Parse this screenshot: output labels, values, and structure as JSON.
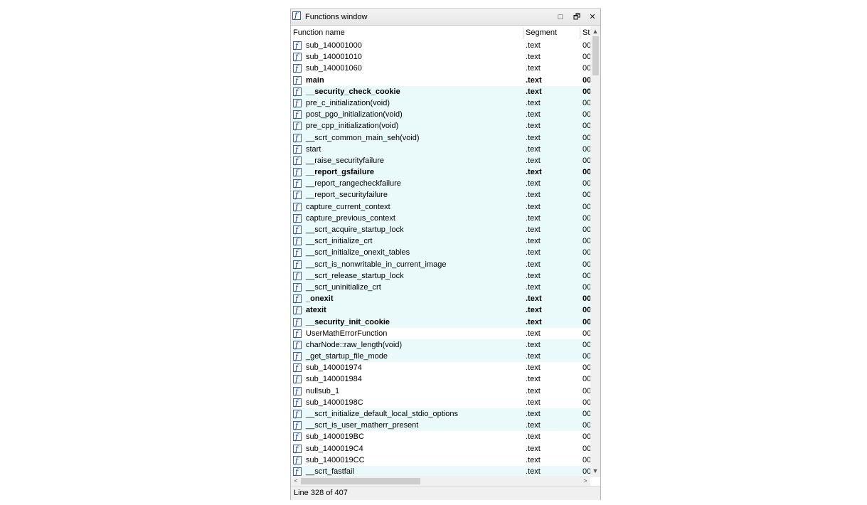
{
  "window": {
    "title": "Functions window",
    "buttons": {
      "maximize": "□",
      "restore": "🗗",
      "close": "✕"
    }
  },
  "columns": {
    "name": "Function name",
    "segment": "Segment",
    "start": "St"
  },
  "rows": [
    {
      "name": "sub_140001000",
      "segment": ".text",
      "start": "00",
      "bold": false,
      "highlight": false
    },
    {
      "name": "sub_140001010",
      "segment": ".text",
      "start": "00",
      "bold": false,
      "highlight": false
    },
    {
      "name": "sub_140001060",
      "segment": ".text",
      "start": "00",
      "bold": false,
      "highlight": false
    },
    {
      "name": "main",
      "segment": ".text",
      "start": "00",
      "bold": true,
      "highlight": false
    },
    {
      "name": "__security_check_cookie",
      "segment": ".text",
      "start": "00",
      "bold": true,
      "highlight": true
    },
    {
      "name": "pre_c_initialization(void)",
      "segment": ".text",
      "start": "00",
      "bold": false,
      "highlight": true
    },
    {
      "name": "post_pgo_initialization(void)",
      "segment": ".text",
      "start": "00",
      "bold": false,
      "highlight": true
    },
    {
      "name": "pre_cpp_initialization(void)",
      "segment": ".text",
      "start": "00",
      "bold": false,
      "highlight": true
    },
    {
      "name": "__scrt_common_main_seh(void)",
      "segment": ".text",
      "start": "00",
      "bold": false,
      "highlight": true
    },
    {
      "name": "start",
      "segment": ".text",
      "start": "00",
      "bold": false,
      "highlight": true
    },
    {
      "name": "__raise_securityfailure",
      "segment": ".text",
      "start": "00",
      "bold": false,
      "highlight": true
    },
    {
      "name": "__report_gsfailure",
      "segment": ".text",
      "start": "00",
      "bold": true,
      "highlight": true
    },
    {
      "name": "__report_rangecheckfailure",
      "segment": ".text",
      "start": "00",
      "bold": false,
      "highlight": true
    },
    {
      "name": "__report_securityfailure",
      "segment": ".text",
      "start": "00",
      "bold": false,
      "highlight": true
    },
    {
      "name": "capture_current_context",
      "segment": ".text",
      "start": "00",
      "bold": false,
      "highlight": true
    },
    {
      "name": "capture_previous_context",
      "segment": ".text",
      "start": "00",
      "bold": false,
      "highlight": true
    },
    {
      "name": "__scrt_acquire_startup_lock",
      "segment": ".text",
      "start": "00",
      "bold": false,
      "highlight": true
    },
    {
      "name": "__scrt_initialize_crt",
      "segment": ".text",
      "start": "00",
      "bold": false,
      "highlight": true
    },
    {
      "name": "__scrt_initialize_onexit_tables",
      "segment": ".text",
      "start": "00",
      "bold": false,
      "highlight": true
    },
    {
      "name": "__scrt_is_nonwritable_in_current_image",
      "segment": ".text",
      "start": "00",
      "bold": false,
      "highlight": true
    },
    {
      "name": "__scrt_release_startup_lock",
      "segment": ".text",
      "start": "00",
      "bold": false,
      "highlight": true
    },
    {
      "name": "__scrt_uninitialize_crt",
      "segment": ".text",
      "start": "00",
      "bold": false,
      "highlight": true
    },
    {
      "name": "_onexit",
      "segment": ".text",
      "start": "00",
      "bold": true,
      "highlight": true
    },
    {
      "name": "atexit",
      "segment": ".text",
      "start": "00",
      "bold": true,
      "highlight": true
    },
    {
      "name": "__security_init_cookie",
      "segment": ".text",
      "start": "00",
      "bold": true,
      "highlight": true
    },
    {
      "name": "UserMathErrorFunction",
      "segment": ".text",
      "start": "00",
      "bold": false,
      "highlight": false
    },
    {
      "name": "charNode::raw_length(void)",
      "segment": ".text",
      "start": "00",
      "bold": false,
      "highlight": true
    },
    {
      "name": "_get_startup_file_mode",
      "segment": ".text",
      "start": "00",
      "bold": false,
      "highlight": true
    },
    {
      "name": "sub_140001974",
      "segment": ".text",
      "start": "00",
      "bold": false,
      "highlight": false
    },
    {
      "name": "sub_140001984",
      "segment": ".text",
      "start": "00",
      "bold": false,
      "highlight": false
    },
    {
      "name": "nullsub_1",
      "segment": ".text",
      "start": "00",
      "bold": false,
      "highlight": false
    },
    {
      "name": "sub_14000198C",
      "segment": ".text",
      "start": "00",
      "bold": false,
      "highlight": false
    },
    {
      "name": "__scrt_initialize_default_local_stdio_options",
      "segment": ".text",
      "start": "00",
      "bold": false,
      "highlight": true
    },
    {
      "name": "__scrt_is_user_matherr_present",
      "segment": ".text",
      "start": "00",
      "bold": false,
      "highlight": true
    },
    {
      "name": "sub_1400019BC",
      "segment": ".text",
      "start": "00",
      "bold": false,
      "highlight": false
    },
    {
      "name": "sub_1400019C4",
      "segment": ".text",
      "start": "00",
      "bold": false,
      "highlight": false
    },
    {
      "name": "sub_1400019CC",
      "segment": ".text",
      "start": "00",
      "bold": false,
      "highlight": false
    },
    {
      "name": "__scrt_fastfail",
      "segment": ".text",
      "start": "00",
      "bold": false,
      "highlight": true
    }
  ],
  "scroll": {
    "up": "▲",
    "down": "▼",
    "left": "<",
    "right": ">"
  },
  "status": {
    "text": "Line 328 of 407"
  }
}
